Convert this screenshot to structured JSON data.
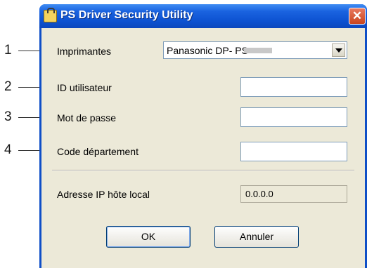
{
  "window": {
    "title": "PS Driver Security Utility",
    "close_glyph": "✕",
    "icon": "app-lock-icon"
  },
  "callouts": [
    "1",
    "2",
    "3",
    "4"
  ],
  "form": {
    "printers_label": "Imprimantes",
    "printer_value": "Panasonic DP-          PS",
    "user_id_label": "ID utilisateur",
    "password_label": "Mot de passe",
    "department_label": "Code département",
    "ip_label": "Adresse IP hôte local",
    "ip_value": "0.0.0.0"
  },
  "buttons": {
    "ok": "OK",
    "cancel": "Annuler"
  },
  "colors": {
    "titlebar": "#0d52d1",
    "client": "#ece9d8",
    "close": "#c9451e"
  }
}
